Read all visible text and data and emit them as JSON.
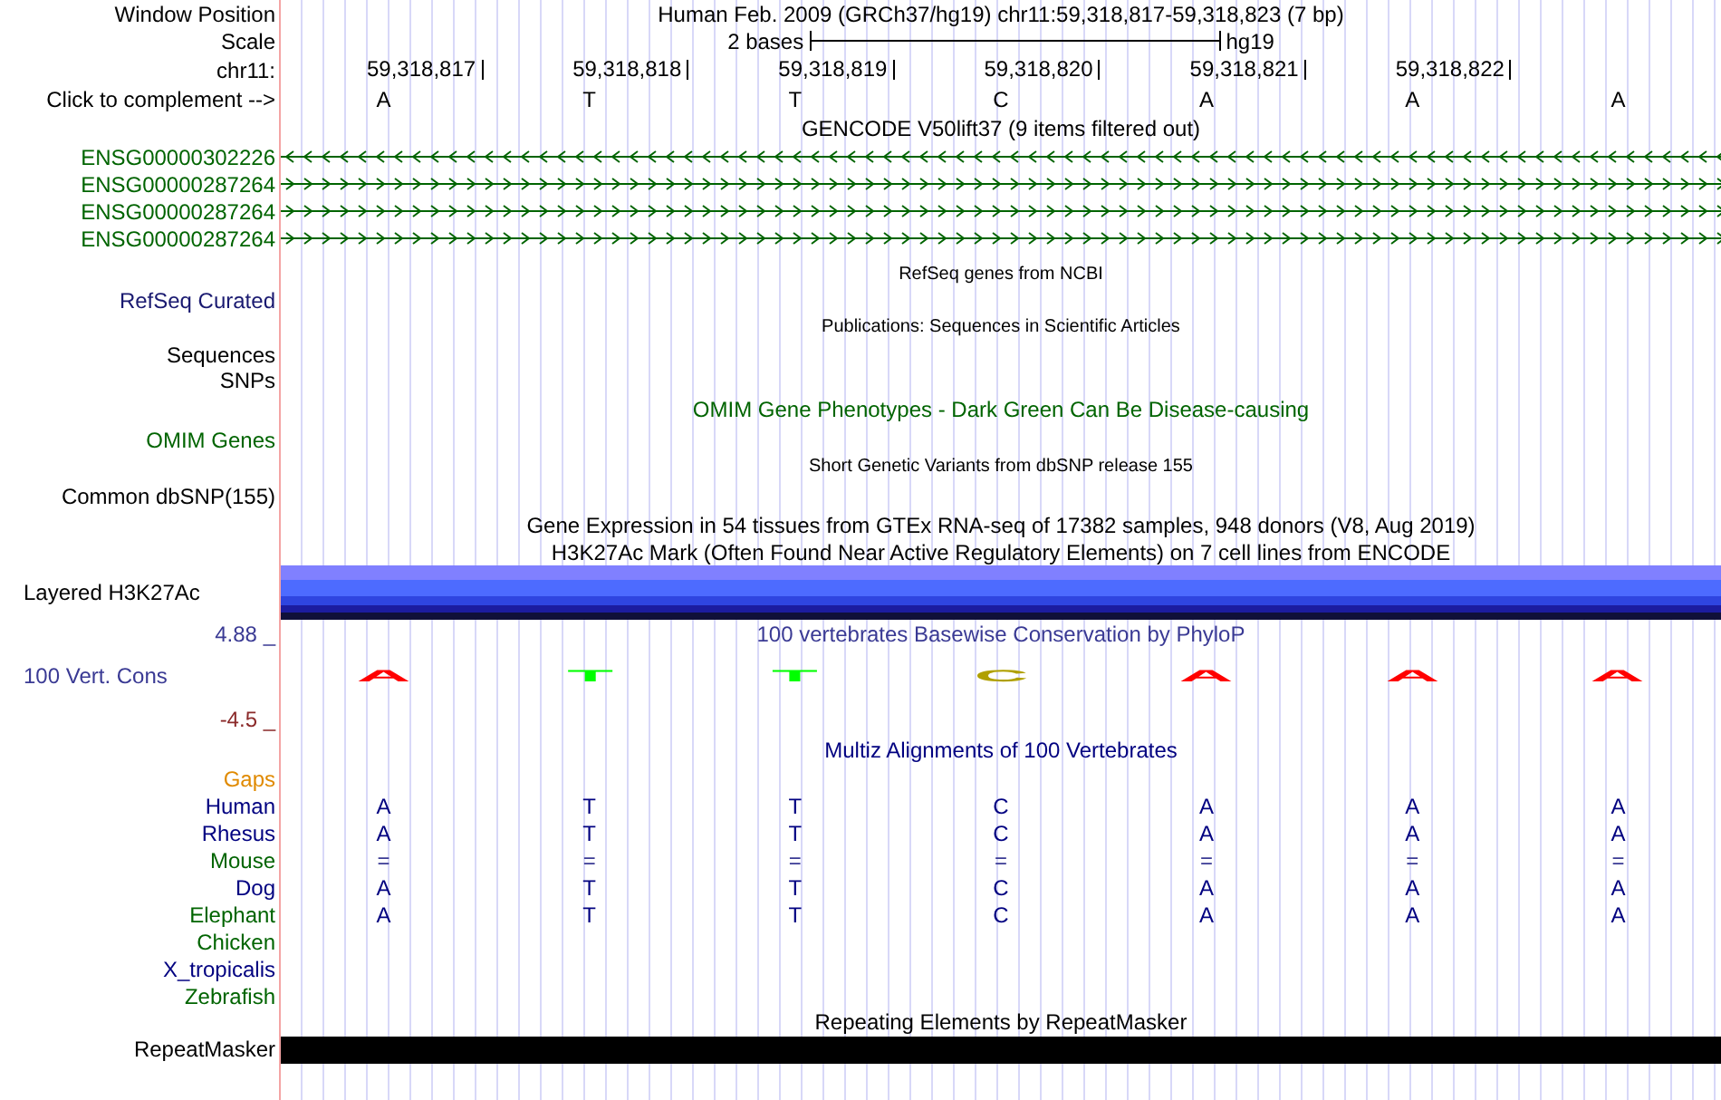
{
  "header": {
    "window_position_label": "Window Position",
    "position_title": "Human Feb. 2009 (GRCh37/hg19)   chr11:59,318,817-59,318,823 (7 bp)",
    "scale_label": "Scale",
    "scale_text": "2 bases",
    "assembly": "hg19",
    "chrom_label": "chr11:",
    "positions": [
      "59,318,817",
      "59,318,818",
      "59,318,819",
      "59,318,820",
      "59,318,821",
      "59,318,822"
    ],
    "complement_label": "Click to complement -->",
    "bases": [
      "A",
      "T",
      "T",
      "C",
      "A",
      "A",
      "A"
    ]
  },
  "tracks": [
    {
      "kind": "genes",
      "title": "GENCODE V50lift37 (9 items filtered out)",
      "items": [
        {
          "name": "ENSG00000302226",
          "color": "#006400",
          "kind": "reverse"
        },
        {
          "name": "ENSG00000287264",
          "color": "#006400",
          "kind": "forward"
        },
        {
          "name": "ENSG00000287264",
          "color": "#006400",
          "kind": "forward"
        },
        {
          "name": "ENSG00000287264",
          "color": "#006400",
          "kind": "forward"
        }
      ]
    },
    {
      "kind": "refseq",
      "title": "RefSeq genes from NCBI",
      "label": "RefSeq Curated",
      "color": "#191970"
    },
    {
      "kind": "publications",
      "title": "Publications: Sequences in Scientific Articles",
      "labels": [
        "Sequences",
        "SNPs"
      ]
    },
    {
      "kind": "omim",
      "title": "OMIM Gene Phenotypes - Dark Green Can Be Disease-causing",
      "label": "OMIM Genes",
      "color": "#006400"
    },
    {
      "kind": "dbsnp",
      "title": "Short Genetic Variants from dbSNP release 155",
      "label": "Common dbSNP(155)",
      "color": "#000000"
    },
    {
      "kind": "gtex",
      "title": "Gene Expression in 54 tissues from GTEx RNA-seq of 17382 samples, 948 donors (V8, Aug 2019)"
    },
    {
      "kind": "h3k27ac",
      "title": "H3K27Ac Mark (Often Found Near Active Regulatory Elements) on 7 cell lines from ENCODE",
      "label": "Layered H3K27Ac"
    },
    {
      "kind": "phylop",
      "title": "100 vertebrates Basewise Conservation by PhyloP",
      "label": "100 Vert. Cons",
      "max_label": "4.88 _",
      "min_label": "-4.5 _",
      "logo": [
        {
          "base": "A",
          "color": "#ff0000"
        },
        {
          "base": "T",
          "color": "#00ff00"
        },
        {
          "base": "T",
          "color": "#00ff00"
        },
        {
          "base": "C",
          "color": "#b0a000"
        },
        {
          "base": "A",
          "color": "#ff0000"
        },
        {
          "base": "A",
          "color": "#ff0000"
        },
        {
          "base": "A",
          "color": "#ff0000"
        }
      ]
    },
    {
      "kind": "multiz",
      "title": "Multiz Alignments of 100 Vertebrates",
      "gaps_label": "Gaps",
      "species": [
        {
          "name": "Human",
          "color": "#000080",
          "bases": [
            "A",
            "T",
            "T",
            "C",
            "A",
            "A",
            "A"
          ]
        },
        {
          "name": "Rhesus",
          "color": "#000080",
          "bases": [
            "A",
            "T",
            "T",
            "C",
            "A",
            "A",
            "A"
          ]
        },
        {
          "name": "Mouse",
          "color": "#006400",
          "bases": [
            "=",
            "=",
            "=",
            "=",
            "=",
            "=",
            "="
          ]
        },
        {
          "name": "Dog",
          "color": "#000080",
          "bases": [
            "A",
            "T",
            "T",
            "C",
            "A",
            "A",
            "A"
          ]
        },
        {
          "name": "Elephant",
          "color": "#006400",
          "bases": [
            "A",
            "T",
            "T",
            "C",
            "A",
            "A",
            "A"
          ]
        },
        {
          "name": "Chicken",
          "color": "#006400"
        },
        {
          "name": "X_tropicalis",
          "color": "#000080"
        },
        {
          "name": "Zebrafish",
          "color": "#006400"
        }
      ]
    },
    {
      "kind": "repeatmasker",
      "title": "Repeating Elements by RepeatMasker",
      "label": "RepeatMasker"
    }
  ]
}
